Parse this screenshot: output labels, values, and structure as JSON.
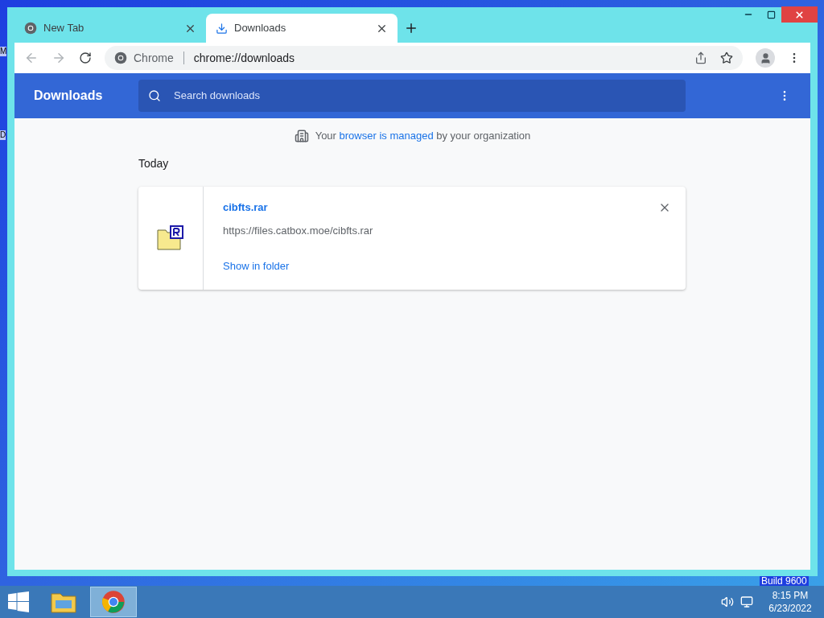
{
  "desktop": {
    "icon_labels": [
      "M",
      "D"
    ],
    "watermark": "Build 9600"
  },
  "tabs": [
    {
      "title": "New Tab",
      "selected": false,
      "kind": "chrome"
    },
    {
      "title": "Downloads",
      "selected": true,
      "kind": "download"
    }
  ],
  "address_bar": {
    "site_label": "Chrome",
    "url": "chrome://downloads"
  },
  "page": {
    "title": "Downloads",
    "search": {
      "placeholder": "Search downloads"
    },
    "managed_notice": {
      "before": "Your",
      "link": "browser is managed",
      "after": "by your organization"
    },
    "section": "Today",
    "downloads": [
      {
        "file_name": "cibfts.rar",
        "url": "https://files.catbox.moe/cibfts.rar",
        "action": "Show in folder"
      }
    ]
  },
  "taskbar": {
    "apps": [
      {
        "kind": "explorer",
        "selected": false
      },
      {
        "kind": "chrome",
        "selected": true
      }
    ],
    "time": "8:15 PM",
    "date": "6/23/2022"
  }
}
